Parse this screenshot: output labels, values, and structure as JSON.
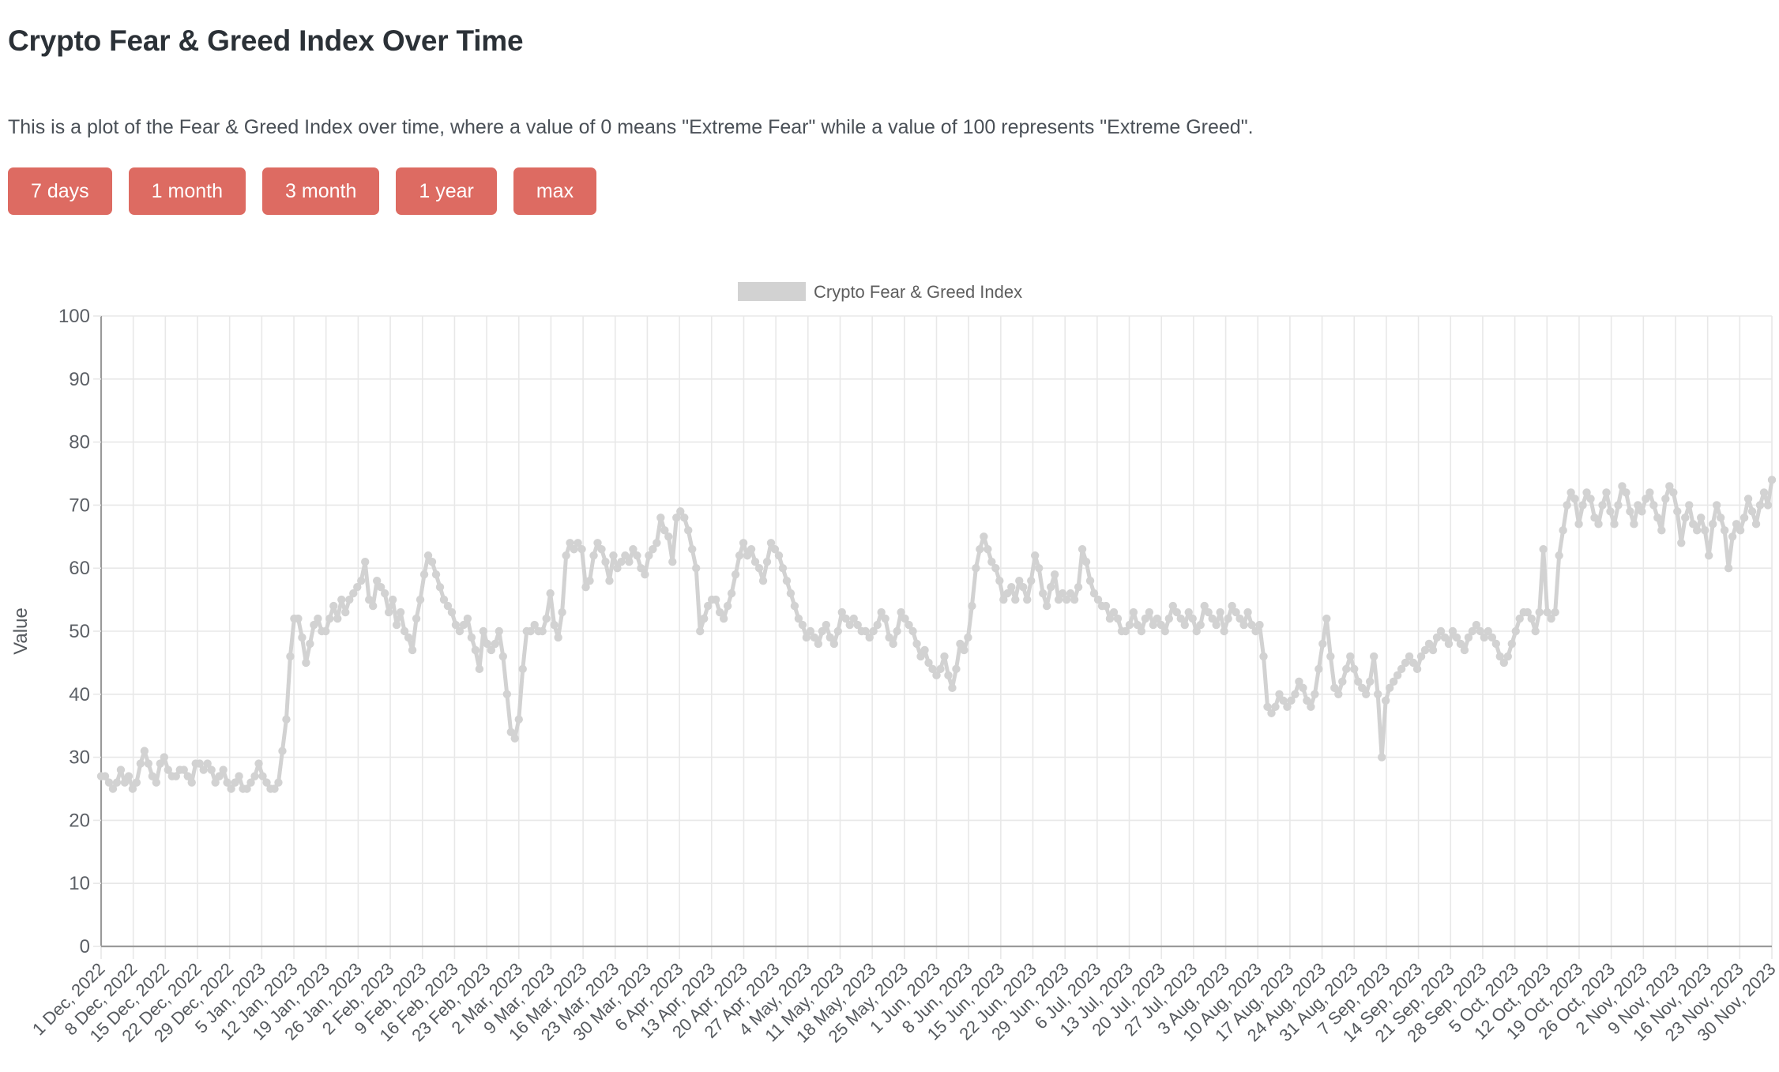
{
  "header": {
    "title": "Crypto Fear & Greed Index Over Time",
    "subtitle": "This is a plot of the Fear & Greed Index over time, where a value of 0 means \"Extreme Fear\" while a value of 100 represents \"Extreme Greed\"."
  },
  "range_buttons": [
    {
      "label": "7 days"
    },
    {
      "label": "1 month"
    },
    {
      "label": "3 month"
    },
    {
      "label": "1 year"
    },
    {
      "label": "max"
    }
  ],
  "theme": {
    "button_bg": "#dd6b62",
    "button_text": "#ffffff",
    "series_color": "#d2d2d2",
    "grid_color": "#e8e8e8",
    "axis_color": "#9a9a9a",
    "title_color": "#2b3137",
    "text_color": "#55595e"
  },
  "chart_data": {
    "type": "line",
    "title": "",
    "xlabel": "",
    "ylabel": "Value",
    "ylim": [
      0,
      100
    ],
    "yticks": [
      0,
      10,
      20,
      30,
      40,
      50,
      60,
      70,
      80,
      90,
      100
    ],
    "grid": true,
    "legend_position": "top-center",
    "legend": [
      "Crypto Fear & Greed Index"
    ],
    "series": [
      {
        "name": "Crypto Fear & Greed Index",
        "color": "#d2d2d2",
        "marker": "circle",
        "values": [
          27,
          27,
          26,
          25,
          26,
          28,
          26,
          27,
          25,
          26,
          29,
          31,
          29,
          27,
          26,
          29,
          30,
          28,
          27,
          27,
          28,
          28,
          27,
          26,
          29,
          29,
          28,
          29,
          28,
          26,
          27,
          28,
          26,
          25,
          26,
          27,
          25,
          25,
          26,
          27,
          29,
          27,
          26,
          25,
          25,
          26,
          31,
          36,
          46,
          52,
          52,
          49,
          45,
          48,
          51,
          52,
          50,
          50,
          52,
          54,
          52,
          55,
          53,
          55,
          56,
          57,
          58,
          61,
          55,
          54,
          58,
          57,
          56,
          53,
          55,
          51,
          53,
          50,
          49,
          47,
          52,
          55,
          59,
          62,
          61,
          59,
          57,
          55,
          54,
          53,
          51,
          50,
          51,
          52,
          49,
          47,
          44,
          50,
          48,
          47,
          48,
          50,
          46,
          40,
          34,
          33,
          36,
          44,
          50,
          50,
          51,
          50,
          50,
          52,
          56,
          51,
          49,
          53,
          62,
          64,
          63,
          64,
          63,
          57,
          58,
          62,
          64,
          63,
          61,
          58,
          62,
          60,
          61,
          62,
          61,
          63,
          62,
          60,
          59,
          62,
          63,
          64,
          68,
          66,
          65,
          61,
          68,
          69,
          68,
          66,
          63,
          60,
          50,
          52,
          54,
          55,
          55,
          53,
          52,
          54,
          56,
          59,
          62,
          64,
          62,
          63,
          61,
          60,
          58,
          61,
          64,
          63,
          62,
          60,
          58,
          56,
          54,
          52,
          51,
          49,
          50,
          49,
          48,
          50,
          51,
          49,
          48,
          50,
          53,
          52,
          51,
          52,
          51,
          50,
          50,
          49,
          50,
          51,
          53,
          52,
          49,
          48,
          50,
          53,
          52,
          51,
          50,
          48,
          46,
          47,
          45,
          44,
          43,
          44,
          46,
          43,
          41,
          44,
          48,
          47,
          49,
          54,
          60,
          63,
          65,
          63,
          61,
          60,
          58,
          55,
          56,
          57,
          55,
          58,
          57,
          55,
          58,
          62,
          60,
          56,
          54,
          57,
          59,
          55,
          56,
          55,
          56,
          55,
          57,
          63,
          61,
          58,
          56,
          55,
          54,
          54,
          52,
          53,
          52,
          50,
          50,
          51,
          53,
          51,
          50,
          52,
          53,
          51,
          52,
          51,
          50,
          52,
          54,
          53,
          52,
          51,
          53,
          52,
          50,
          51,
          54,
          53,
          52,
          51,
          53,
          50,
          52,
          54,
          53,
          52,
          51,
          53,
          51,
          50,
          51,
          46,
          38,
          37,
          38,
          40,
          39,
          38,
          39,
          40,
          42,
          41,
          39,
          38,
          40,
          44,
          48,
          52,
          46,
          41,
          40,
          42,
          44,
          46,
          44,
          42,
          41,
          40,
          42,
          46,
          40,
          30,
          39,
          41,
          42,
          43,
          44,
          45,
          46,
          45,
          44,
          46,
          47,
          48,
          47,
          49,
          50,
          49,
          48,
          50,
          49,
          48,
          47,
          49,
          50,
          51,
          50,
          49,
          50,
          49,
          48,
          46,
          45,
          46,
          48,
          50,
          52,
          53,
          53,
          52,
          50,
          53,
          63,
          53,
          52,
          53,
          62,
          66,
          70,
          72,
          71,
          67,
          70,
          72,
          71,
          68,
          67,
          70,
          72,
          69,
          67,
          70,
          73,
          72,
          69,
          67,
          70,
          69,
          71,
          72,
          70,
          68,
          66,
          71,
          73,
          72,
          69,
          64,
          68,
          70,
          67,
          66,
          68,
          66,
          62,
          67,
          70,
          68,
          66,
          60,
          65,
          67,
          66,
          68,
          71,
          69,
          67,
          70,
          72,
          70,
          74
        ]
      }
    ],
    "x_tick_labels": [
      "1 Dec, 2022",
      "8 Dec, 2022",
      "15 Dec, 2022",
      "22 Dec, 2022",
      "29 Dec, 2022",
      "5 Jan, 2023",
      "12 Jan, 2023",
      "19 Jan, 2023",
      "26 Jan, 2023",
      "2 Feb, 2023",
      "9 Feb, 2023",
      "16 Feb, 2023",
      "23 Feb, 2023",
      "2 Mar, 2023",
      "9 Mar, 2023",
      "16 Mar, 2023",
      "23 Mar, 2023",
      "30 Mar, 2023",
      "6 Apr, 2023",
      "13 Apr, 2023",
      "20 Apr, 2023",
      "27 Apr, 2023",
      "4 May, 2023",
      "11 May, 2023",
      "18 May, 2023",
      "25 May, 2023",
      "1 Jun, 2023",
      "8 Jun, 2023",
      "15 Jun, 2023",
      "22 Jun, 2023",
      "29 Jun, 2023",
      "6 Jul, 2023",
      "13 Jul, 2023",
      "20 Jul, 2023",
      "27 Jul, 2023",
      "3 Aug, 2023",
      "10 Aug, 2023",
      "17 Aug, 2023",
      "24 Aug, 2023",
      "31 Aug, 2023",
      "7 Sep, 2023",
      "14 Sep, 2023",
      "21 Sep, 2023",
      "28 Sep, 2023",
      "5 Oct, 2023",
      "12 Oct, 2023",
      "19 Oct, 2023",
      "26 Oct, 2023",
      "2 Nov, 2023",
      "9 Nov, 2023",
      "16 Nov, 2023",
      "23 Nov, 2023",
      "30 Nov, 2023"
    ]
  }
}
